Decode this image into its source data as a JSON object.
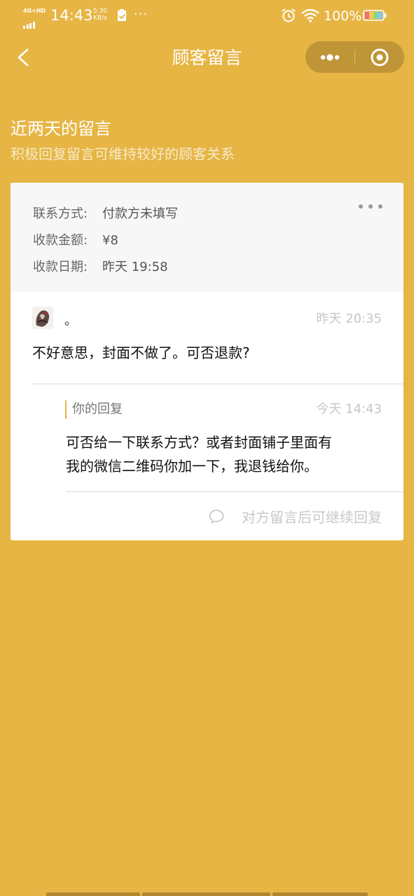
{
  "status_bar": {
    "network": "4G+HD",
    "time": "14:43",
    "speed_value": "5.30",
    "speed_unit": "KB/s",
    "more_dots": "···",
    "battery_percent": "100%"
  },
  "nav": {
    "title": "顾客留言"
  },
  "header": {
    "heading": "近两天的留言",
    "subheading": "积极回复留言可维持较好的顾客关系"
  },
  "order_info": {
    "contact_label": "联系方式:",
    "contact_value": "付款方未填写",
    "amount_label": "收款金额:",
    "amount_value": "¥8",
    "date_label": "收款日期:",
    "date_value": "昨天 19:58"
  },
  "customer_message": {
    "name": "。",
    "time": "昨天 20:35",
    "text": "不好意思，封面不做了。可否退款?"
  },
  "reply": {
    "label": "你的回复",
    "time": "今天 14:43",
    "line1": "可否给一下联系方式？或者封面铺子里面有",
    "line2": "我的微信二维码你加一下，我退钱给你。"
  },
  "footer": {
    "continue_hint": "对方留言后可继续回复"
  },
  "colors": {
    "background": "#E6B544",
    "card": "#FFFFFF",
    "order_info_bg": "#F7F7F7"
  },
  "icons": {
    "back": "back-chevron-icon",
    "menu": "more-dots-icon",
    "close": "target-circle-icon",
    "card_more": "ellipsis-icon",
    "comment": "comment-bubble-icon"
  }
}
